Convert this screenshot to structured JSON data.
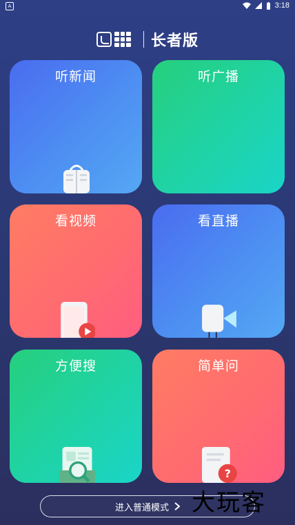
{
  "status_bar": {
    "time": "3:18"
  },
  "header": {
    "title": "长者版"
  },
  "tiles": [
    {
      "label": "听新闻",
      "icon": "book-icon"
    },
    {
      "label": "听广播",
      "icon": ""
    },
    {
      "label": "看视频",
      "icon": "video-phone-icon"
    },
    {
      "label": "看直播",
      "icon": "video-camera-icon"
    },
    {
      "label": "方便搜",
      "icon": "search-doc-icon"
    },
    {
      "label": "简单问",
      "icon": "question-doc-icon"
    }
  ],
  "footer": {
    "mode_button": "进入普通模式"
  },
  "watermark": "大玩客",
  "colors": {
    "blue_tile": "#4d8ff2",
    "green_tile": "#1fd3a7",
    "red_tile": "#ff6c6f",
    "background": "#2a3770"
  }
}
